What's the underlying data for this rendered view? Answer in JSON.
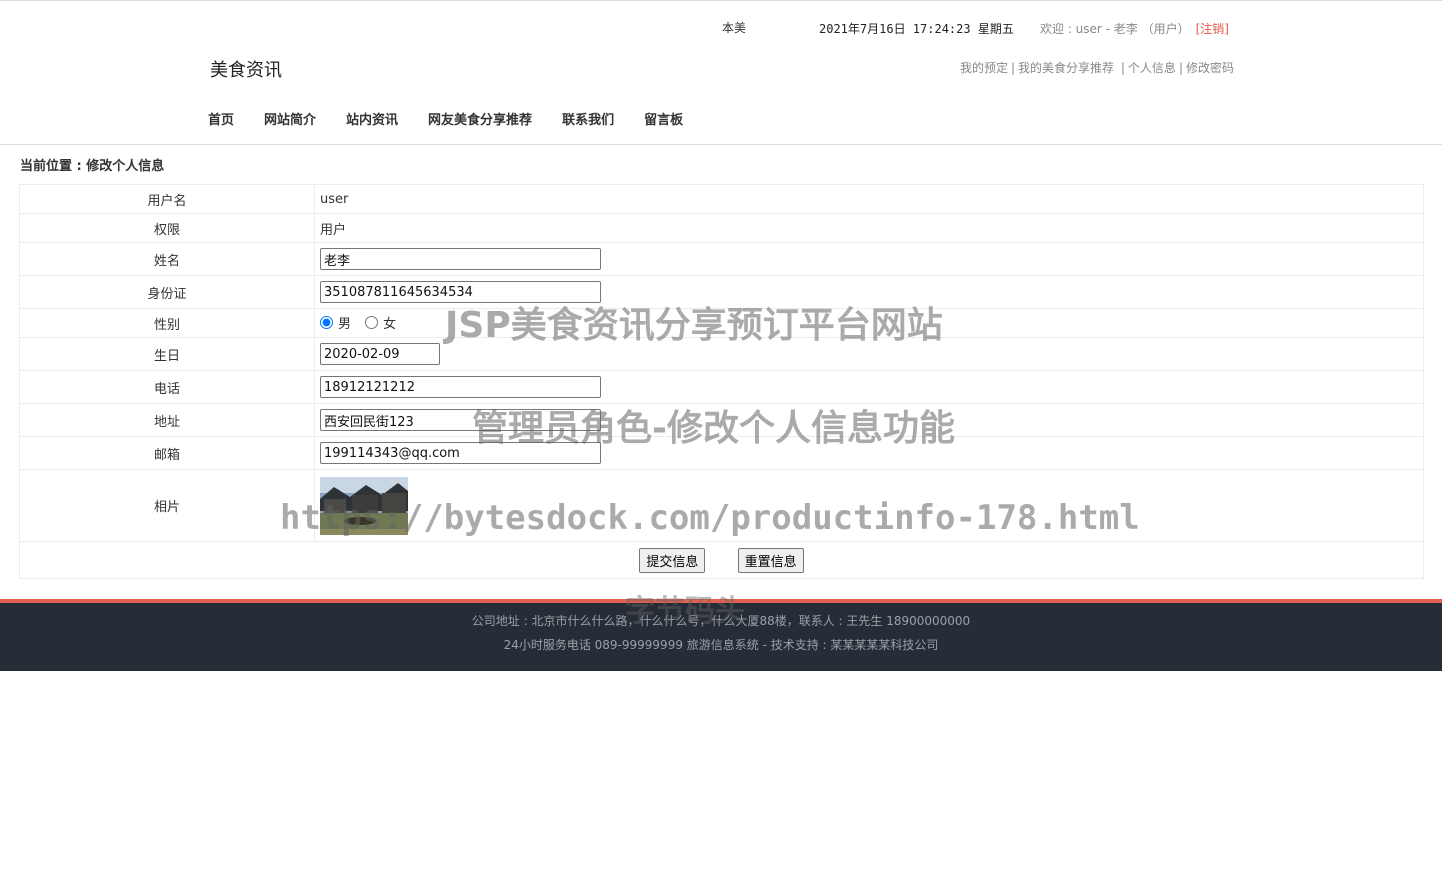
{
  "header": {
    "weather": "本美",
    "datetime": "2021年7月16日 17:24:23 星期五",
    "welcome": "欢迎 : user - 老李 （用户）",
    "logout": "[注销]",
    "site_title": "美食资讯",
    "user_links": [
      "我的预定",
      "我的美食分享推荐",
      "个人信息",
      "修改密码"
    ]
  },
  "nav": [
    "首页",
    "网站简介",
    "站内资讯",
    "网友美食分享推荐",
    "联系我们",
    "留言板"
  ],
  "breadcrumb": "当前位置 : 修改个人信息",
  "form": {
    "username_label": "用户名",
    "username": "user",
    "role_label": "权限",
    "role": "用户",
    "name_label": "姓名",
    "name": "老李",
    "idcard_label": "身份证",
    "idcard": "351087811645634534",
    "gender_label": "性别",
    "gender_male": "男",
    "gender_female": "女",
    "birthday_label": "生日",
    "birthday": "2020-02-09",
    "phone_label": "电话",
    "phone": "18912121212",
    "address_label": "地址",
    "address": "西安回民街123",
    "email_label": "邮箱",
    "email": "199114343@qq.com",
    "photo_label": "相片",
    "submit": "提交信息",
    "reset": "重置信息"
  },
  "footer": {
    "line1": "公司地址 : 北京市什么什么路，什么什么号，什么大厦88楼，联系人 : 王先生 18900000000",
    "line2": "24小时服务电话   089-99999999   旅游信息系统 - 技术支持 : 某某某某某科技公司"
  },
  "watermarks": {
    "w1": "JSP美食资讯分享预订平台网站",
    "w2": "管理员角色-修改个人信息功能",
    "w3": "https://bytesdock.com/productinfo-178.html",
    "w4": "字节码头"
  },
  "colors": {
    "accent": "#e0614f",
    "footer_bg": "#262d37",
    "logout": "#e8584a"
  }
}
